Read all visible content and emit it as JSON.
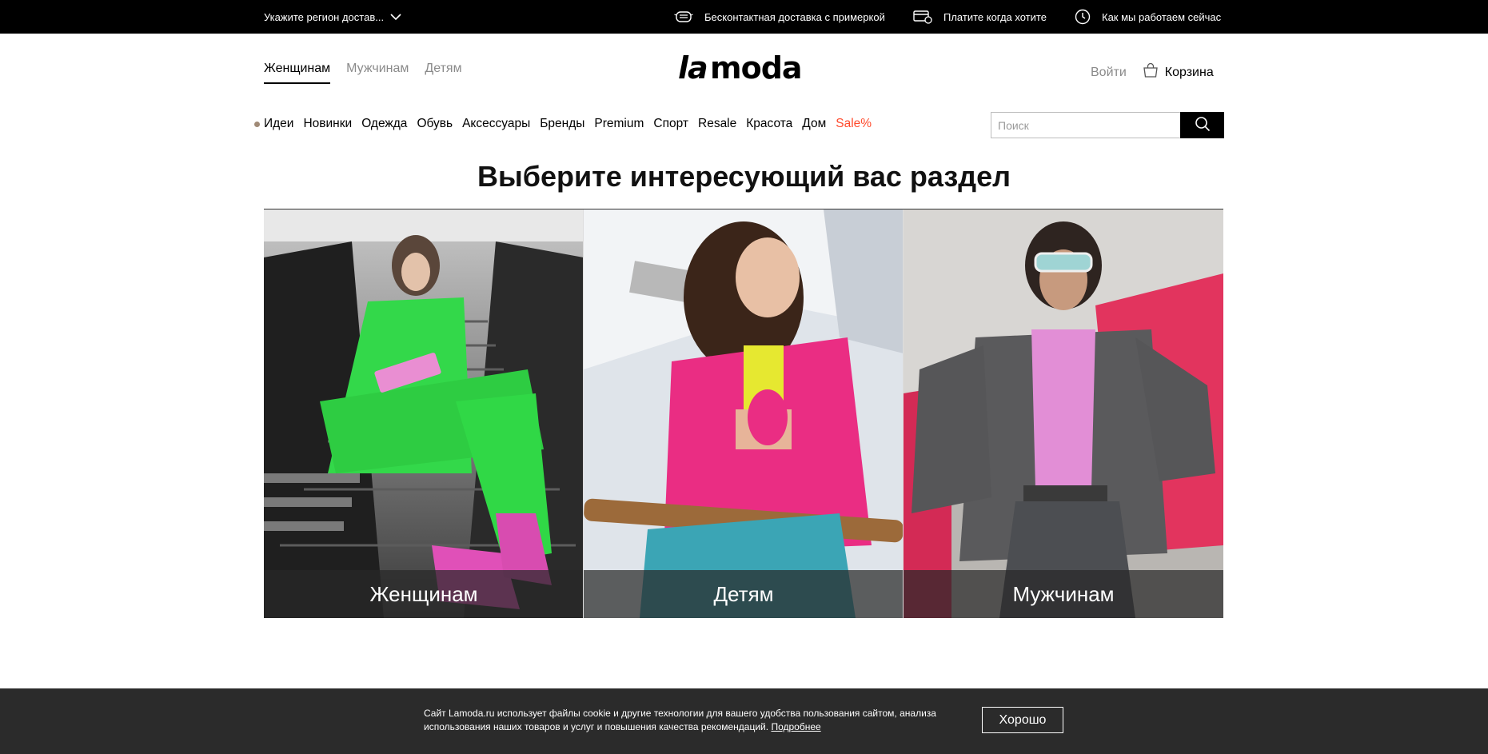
{
  "topbar": {
    "region_label": "Укажите регион достав...",
    "features": [
      {
        "icon": "delivery-mask-icon",
        "label": "Бесконтактная доставка с примеркой"
      },
      {
        "icon": "payment-card-icon",
        "label": "Платите когда хотите"
      },
      {
        "icon": "clock-icon",
        "label": "Как мы работаем сейчас"
      }
    ]
  },
  "header": {
    "gender_tabs": [
      "Женщинам",
      "Мужчинам",
      "Детям"
    ],
    "active_gender": "Женщинам",
    "logo": "lamoda",
    "login_label": "Войти",
    "cart_label": "Корзина"
  },
  "categories": {
    "items": [
      "Идеи",
      "Новинки",
      "Одежда",
      "Обувь",
      "Аксессуары",
      "Бренды",
      "Premium",
      "Спорт",
      "Resale",
      "Красота",
      "Дом",
      "Sale%"
    ],
    "sale_color": "#ff4a2c"
  },
  "search": {
    "placeholder": "Поиск"
  },
  "main": {
    "title": "Выберите интересующий вас раздел",
    "cards": [
      {
        "label": "Женщинам",
        "image": "woman-in-green-suit-on-escalator"
      },
      {
        "label": "Детям",
        "image": "girl-in-pink-jacket"
      },
      {
        "label": "Мужчинам",
        "image": "man-in-grey-suit-sunglasses"
      }
    ]
  },
  "cookie": {
    "text": "Сайт Lamoda.ru использует файлы cookie и другие технологии для вашего удобства пользования сайтом, анализа использования наших товаров и услуг и повышения качества рекомендаций.",
    "more_label": "Подробнее",
    "ok_label": "Хорошо"
  }
}
